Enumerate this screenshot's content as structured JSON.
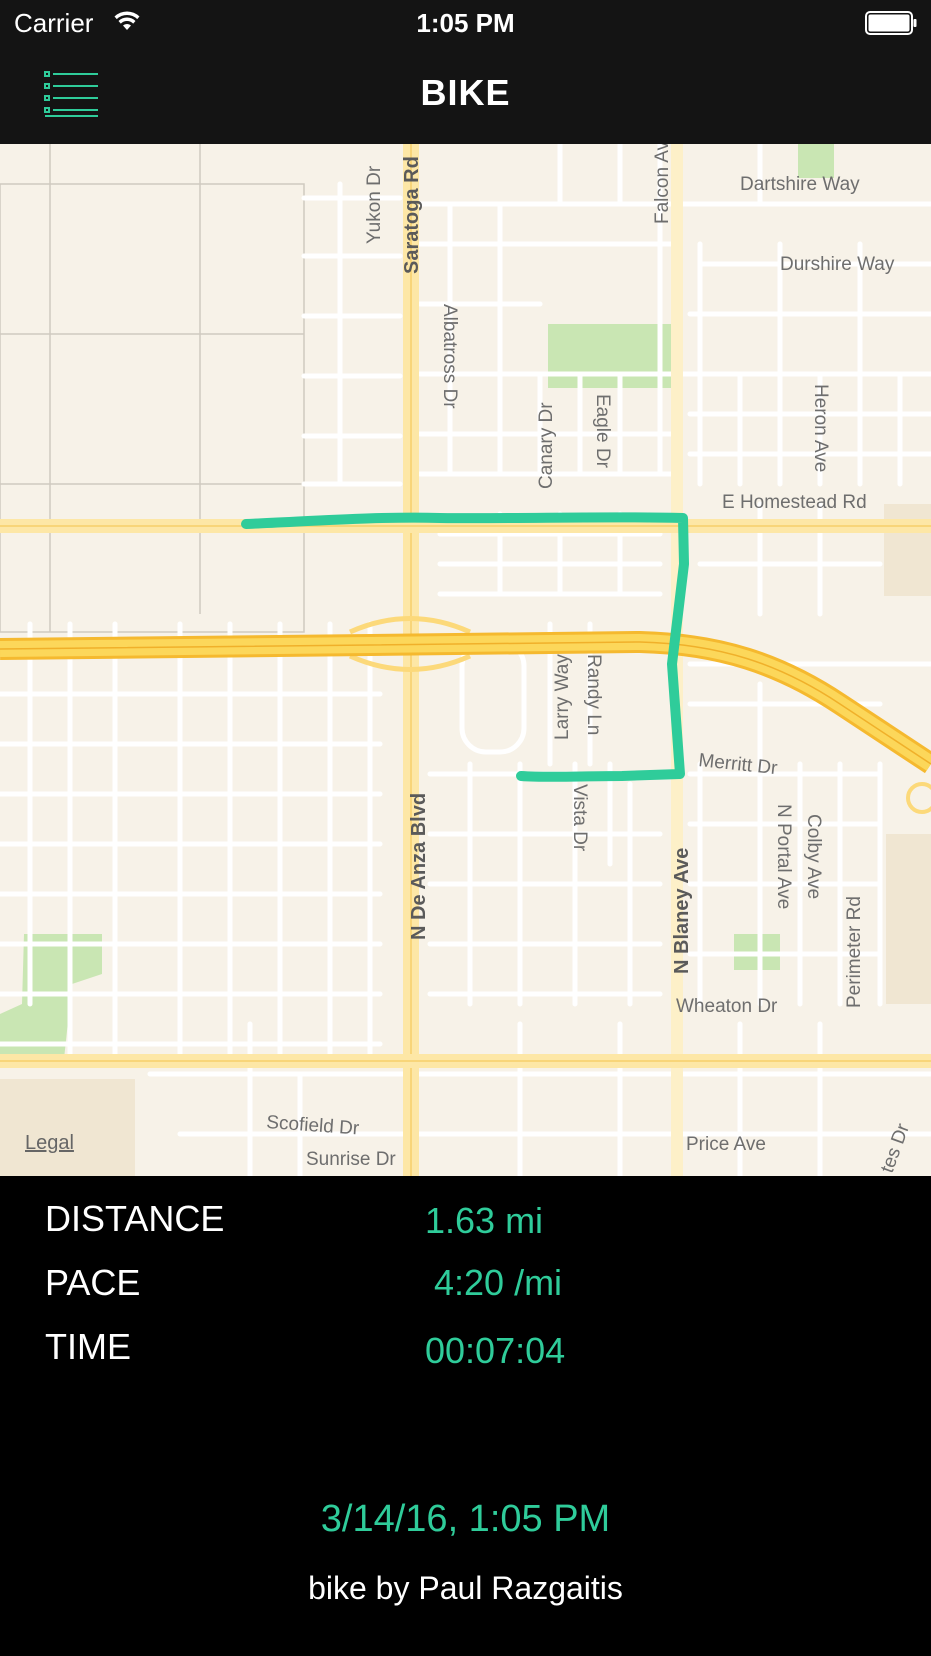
{
  "status_bar": {
    "carrier": "Carrier",
    "time": "1:05 PM",
    "icons": [
      "wifi-icon",
      "battery-icon"
    ]
  },
  "nav": {
    "title": "BIKE",
    "menu_icon": "list-menu-icon",
    "accent_color": "#2fcc9a"
  },
  "map": {
    "legal": "Legal",
    "route_color": "#2fcc9a",
    "street_labels": {
      "saratoga": "Saratoga Rd",
      "yukon": "Yukon Dr",
      "albatross": "Albatross Dr",
      "falcon": "Falcon Av",
      "dartshire": "Dartshire Way",
      "durshire": "Durshire Way",
      "canary": "Canary Dr",
      "eagle": "Eagle Dr",
      "heron": "Heron Ave",
      "homestead": "E Homestead Rd",
      "larry": "Larry Way",
      "randy": "Randy Ln",
      "de_anza": "N De Anza Blvd",
      "vista": "Vista Dr",
      "merritt": "Merritt Dr",
      "blaney": "N Blaney Ave",
      "portal": "N Portal Ave",
      "colby": "Colby Ave",
      "perimeter": "Perimeter Rd",
      "wheaton": "Wheaton Dr",
      "scofield": "Scofield Dr",
      "sunrise": "Sunrise Dr",
      "price": "Price Ave",
      "tes": "tes Dr"
    }
  },
  "stats": {
    "distance_label": "DISTANCE",
    "distance_value": "1.63 mi",
    "pace_label": "PACE",
    "pace_value": "4:20 /mi",
    "time_label": "TIME",
    "time_value": "00:07:04"
  },
  "footer": {
    "date": "3/14/16, 1:05 PM",
    "credit": "bike by Paul Razgaitis"
  }
}
